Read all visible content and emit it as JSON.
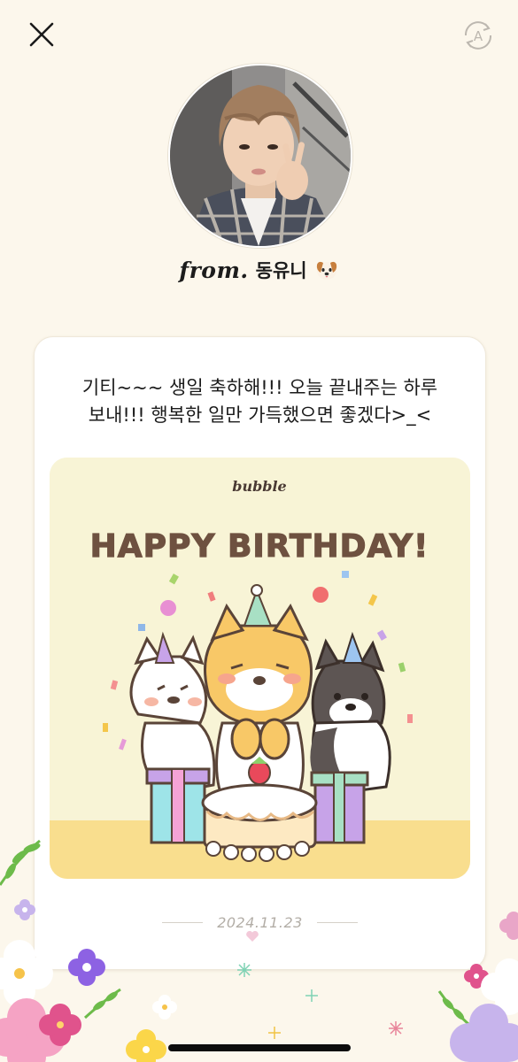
{
  "header": {
    "close_icon": "close-icon",
    "translate_icon": "auto-translate-icon"
  },
  "sender": {
    "from_prefix": "from.",
    "name": "동유니",
    "emoji": "dog-face-emoji"
  },
  "letter": {
    "message": "기티~~~ 생일 축하해!!! 오늘 끝내주는 하루 보내!!! 행복한 일만 가득했으면 좋겠다>_<",
    "image": {
      "brand": "bubble",
      "headline": "HAPPY BIRTHDAY!"
    },
    "date": "2024.11.23",
    "heart_icon": "heart-icon"
  },
  "colors": {
    "background": "#fcf7ec",
    "card": "#ffffff",
    "image_bg": "#f8f4d6",
    "headline": "#6e5140",
    "date": "#b2ada6"
  }
}
